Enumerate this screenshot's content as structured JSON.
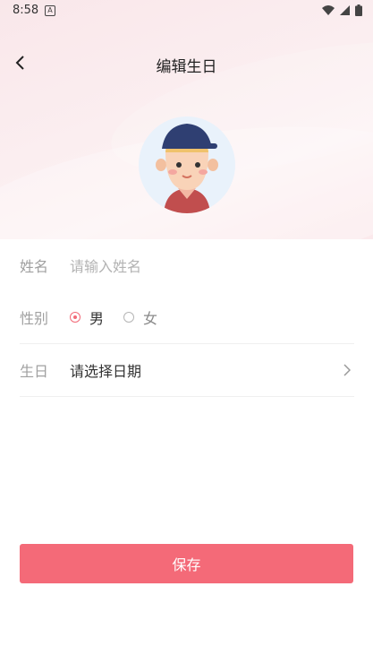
{
  "status_bar": {
    "time": "8:58",
    "notif_icon_letter": "A"
  },
  "header": {
    "title": "编辑生日"
  },
  "form": {
    "name_label": "姓名",
    "name_placeholder": "请输入姓名",
    "gender_label": "性别",
    "gender_male": "男",
    "gender_female": "女",
    "gender_selected": "男",
    "birthday_label": "生日",
    "birthday_value": "请选择日期"
  },
  "actions": {
    "save_label": "保存"
  },
  "colors": {
    "accent": "#f46a78",
    "radio_selected": "#f26a78"
  }
}
